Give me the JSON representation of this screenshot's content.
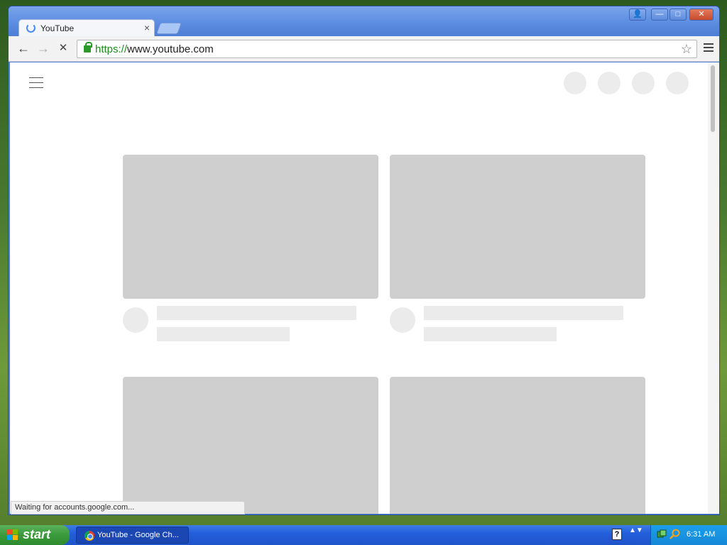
{
  "browser": {
    "tab_title": "YouTube",
    "tab_close": "×",
    "url_scheme": "https://",
    "url_rest": "www.youtube.com",
    "back": "←",
    "forward": "→",
    "stop": "✕",
    "star": "☆",
    "window_controls": [
      "👤",
      "—",
      "□",
      "✕"
    ]
  },
  "page": {
    "status_text": "Waiting for accounts.google.com..."
  },
  "taskbar": {
    "start_label": "start",
    "task_label": "YouTube - Google Ch...",
    "help": "?",
    "arrows": "▲▼",
    "clock": "6:31 AM"
  },
  "colors": {
    "skeleton_thumb": "#cfcfcf",
    "skeleton_line": "#ebebeb",
    "secure_green": "#1f8c1f",
    "taskbar_blue": "#245edb"
  }
}
